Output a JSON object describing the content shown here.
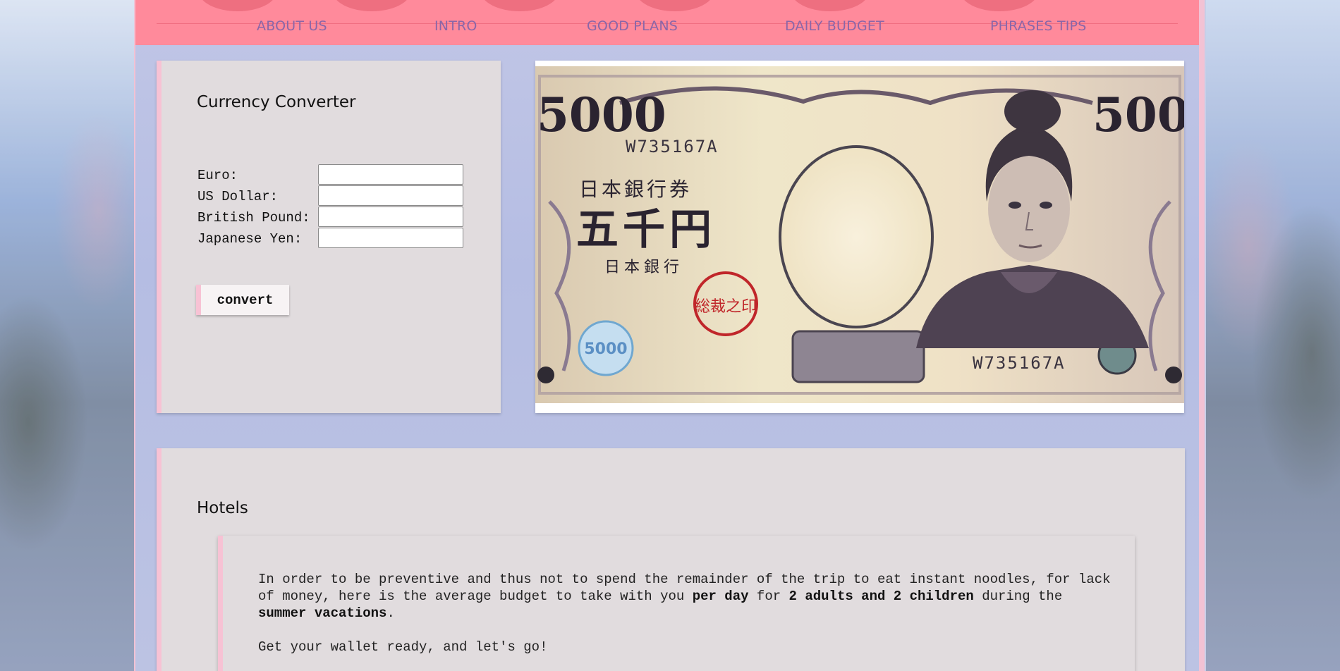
{
  "nav": {
    "items": [
      {
        "label": "ABOUT US"
      },
      {
        "label": "INTRO"
      },
      {
        "label": "GOOD PLANS"
      },
      {
        "label": "DAILY BUDGET"
      },
      {
        "label": "PHRASES TIPS"
      }
    ]
  },
  "converter": {
    "title": "Currency Converter",
    "fields": [
      {
        "label": "Euro:",
        "value": ""
      },
      {
        "label": "US Dollar:",
        "value": ""
      },
      {
        "label": "British Pound:",
        "value": ""
      },
      {
        "label": "Japanese Yen:",
        "value": ""
      }
    ],
    "button_label": "convert"
  },
  "banknote": {
    "denomination": "5000",
    "serial": "W735167A",
    "issuer_text": "日本銀行券",
    "value_text": "五千円",
    "bank_text": "日本銀行",
    "seal_text": "総裁之印",
    "hologram_text": "5000"
  },
  "hotels": {
    "title": "Hotels",
    "para1": {
      "t1": "In order to be preventive and thus not to spend the remainder of the trip to eat instant noodles, for lack of money, here is the average budget to take with you ",
      "b1": "per day",
      "t2": " for ",
      "b2": "2 adults and 2 children",
      "t3": " during the ",
      "b3": "summer vacations",
      "t4": "."
    },
    "para2": "Get your wallet ready, and let's go!"
  },
  "colors": {
    "nav_bg": "#ff8a9b",
    "nav_text": "#8a66a8",
    "card_bg": "#e1dcde",
    "card_accent": "#f7c2d4"
  }
}
